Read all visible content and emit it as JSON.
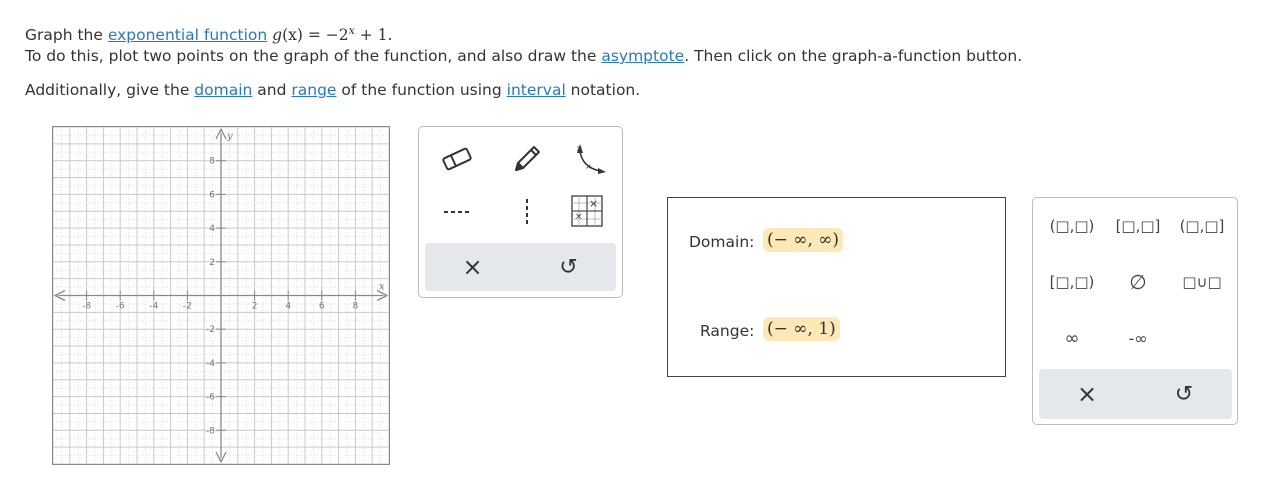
{
  "instructions": {
    "line1_pre": "Graph the ",
    "line1_link": "exponential function",
    "fn_name": "g",
    "fn_lhs_rest": "(x) = −2",
    "fn_exp": "x",
    "fn_tail": " + 1.",
    "line2_pre": "To do this, plot two points on the graph of the function, and also draw the ",
    "line2_link": "asymptote",
    "line2_post": ". Then click on the graph-a-function button.",
    "line3_pre": "Additionally, give the ",
    "line3_link1": "domain",
    "line3_mid1": " and ",
    "line3_link2": "range",
    "line3_mid2": " of the function using ",
    "line3_link3": "interval",
    "line3_post": " notation."
  },
  "graph": {
    "x_axis_label": "x",
    "y_axis_label": "y",
    "x_ticks": [
      "-8",
      "-6",
      "-4",
      "-2",
      "2",
      "4",
      "6",
      "8"
    ],
    "y_ticks": [
      "8",
      "6",
      "4",
      "2",
      "-2",
      "-4",
      "-6",
      "-8"
    ],
    "x_range": [
      -10,
      10
    ],
    "y_range": [
      -10,
      10
    ]
  },
  "toolbox": {
    "tools": [
      "eraser-tool",
      "pencil-tool",
      "exponential-curve-tool",
      "dashed-line-tool",
      "vertical-dashed-line-tool",
      "graph-function-tool"
    ],
    "clear_symbol": "×",
    "undo_symbol": "↺"
  },
  "answers": {
    "domain_label": "Domain:",
    "domain_value": "(− ∞, ∞)",
    "range_label": "Range:",
    "range_value": "(− ∞, 1)"
  },
  "keypad": {
    "row1": [
      "(□,□)",
      "[□,□]",
      "(□,□]"
    ],
    "row2": [
      "[□,□)",
      "∅",
      "□∪□"
    ],
    "row3": [
      "∞",
      "-∞"
    ],
    "clear_symbol": "×",
    "undo_symbol": "↺"
  }
}
